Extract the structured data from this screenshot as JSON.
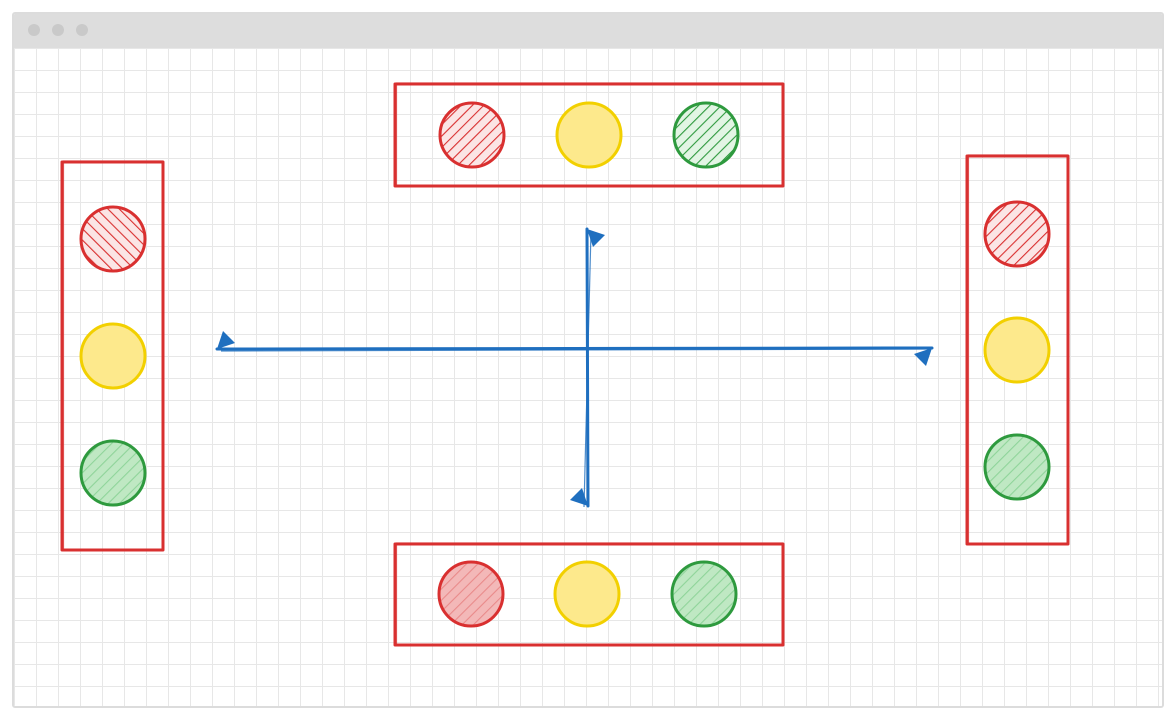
{
  "window": {
    "controls": [
      {
        "name": "close-dot",
        "color": "#c9c9c9"
      },
      {
        "name": "minimize-dot",
        "color": "#c9c9c9"
      },
      {
        "name": "maximize-dot",
        "color": "#c9c9c9"
      }
    ]
  },
  "colors": {
    "frame": "#d93030",
    "red_light": "#d93030",
    "red_fill": "#f3b8b8",
    "yellow_light": "#f2d000",
    "yellow_fill": "#fde98c",
    "green_light": "#2e9a3e",
    "green_fill": "#bfe8c3",
    "arrow": "#1f6fbf",
    "grid": "#e7e7e7"
  },
  "traffic_lights": [
    {
      "id": "north",
      "orientation": "horizontal",
      "lights": [
        "red",
        "yellow",
        "green"
      ]
    },
    {
      "id": "west",
      "orientation": "vertical",
      "lights": [
        "red",
        "yellow",
        "green"
      ]
    },
    {
      "id": "east",
      "orientation": "vertical",
      "lights": [
        "red",
        "yellow",
        "green"
      ]
    },
    {
      "id": "south",
      "orientation": "horizontal",
      "lights": [
        "red",
        "yellow",
        "green"
      ]
    }
  ],
  "arrows": [
    "horizontal-double-arrow",
    "vertical-double-arrow"
  ]
}
